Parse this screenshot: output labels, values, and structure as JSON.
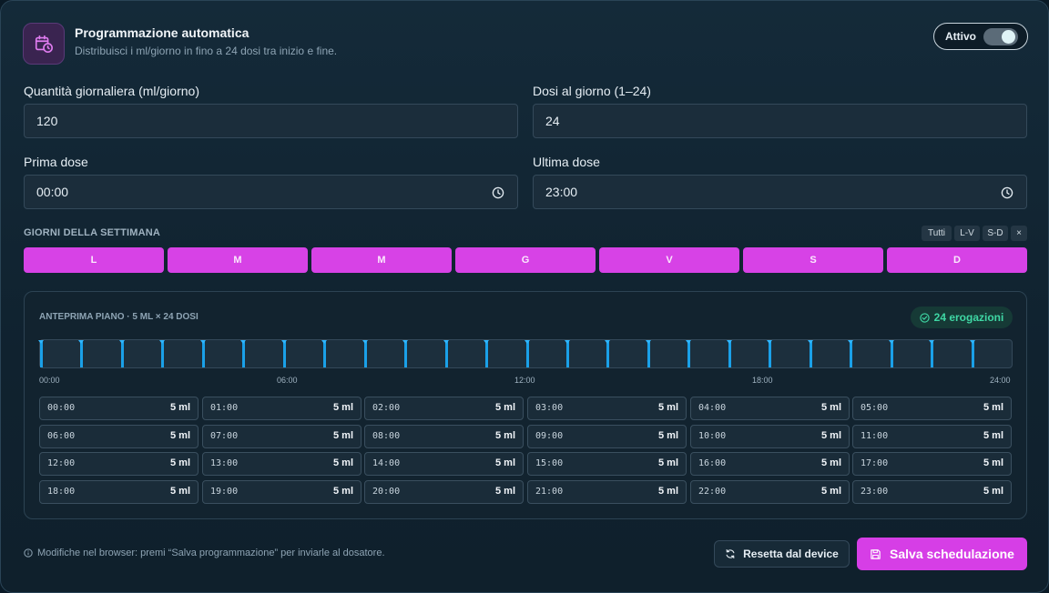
{
  "header": {
    "title": "Programmazione automatica",
    "subtitle": "Distribuisci i ml/giorno in fino a 24 dosi tra inizio e fine.",
    "toggle_label": "Attivo",
    "toggle_on": true
  },
  "fields": {
    "daily_label": "Quantità giornaliera (ml/giorno)",
    "daily_value": "120",
    "doses_label": "Dosi al giorno (1–24)",
    "doses_value": "24",
    "first_label": "Prima dose",
    "first_value": "00:00",
    "last_label": "Ultima dose",
    "last_value": "23:00"
  },
  "weekdays": {
    "title": "GIORNI DELLA SETTIMANA",
    "quick": [
      "Tutti",
      "L-V",
      "S-D",
      "×"
    ],
    "days": [
      "L",
      "M",
      "M",
      "G",
      "V",
      "S",
      "D"
    ],
    "active_color": "#d742e6"
  },
  "preview": {
    "title": "ANTEPRIMA PIANO · 5 ML × 24 DOSI",
    "badge": "24 erogazioni",
    "axis": [
      "00:00",
      "06:00",
      "12:00",
      "18:00",
      "24:00"
    ],
    "slots": [
      {
        "time": "00:00",
        "amount": "5 ml"
      },
      {
        "time": "01:00",
        "amount": "5 ml"
      },
      {
        "time": "02:00",
        "amount": "5 ml"
      },
      {
        "time": "03:00",
        "amount": "5 ml"
      },
      {
        "time": "04:00",
        "amount": "5 ml"
      },
      {
        "time": "05:00",
        "amount": "5 ml"
      },
      {
        "time": "06:00",
        "amount": "5 ml"
      },
      {
        "time": "07:00",
        "amount": "5 ml"
      },
      {
        "time": "08:00",
        "amount": "5 ml"
      },
      {
        "time": "09:00",
        "amount": "5 ml"
      },
      {
        "time": "10:00",
        "amount": "5 ml"
      },
      {
        "time": "11:00",
        "amount": "5 ml"
      },
      {
        "time": "12:00",
        "amount": "5 ml"
      },
      {
        "time": "13:00",
        "amount": "5 ml"
      },
      {
        "time": "14:00",
        "amount": "5 ml"
      },
      {
        "time": "15:00",
        "amount": "5 ml"
      },
      {
        "time": "16:00",
        "amount": "5 ml"
      },
      {
        "time": "17:00",
        "amount": "5 ml"
      },
      {
        "time": "18:00",
        "amount": "5 ml"
      },
      {
        "time": "19:00",
        "amount": "5 ml"
      },
      {
        "time": "20:00",
        "amount": "5 ml"
      },
      {
        "time": "21:00",
        "amount": "5 ml"
      },
      {
        "time": "22:00",
        "amount": "5 ml"
      },
      {
        "time": "23:00",
        "amount": "5 ml"
      }
    ]
  },
  "footer": {
    "note": "Modifiche nel browser: premi “Salva programmazione” per inviarle al dosatore.",
    "reset_label": "Resetta dal device",
    "save_label": "Salva schedulazione"
  },
  "colors": {
    "accent": "#d63ee6",
    "tick": "#1aa0e8",
    "success": "#3fd7a4"
  }
}
